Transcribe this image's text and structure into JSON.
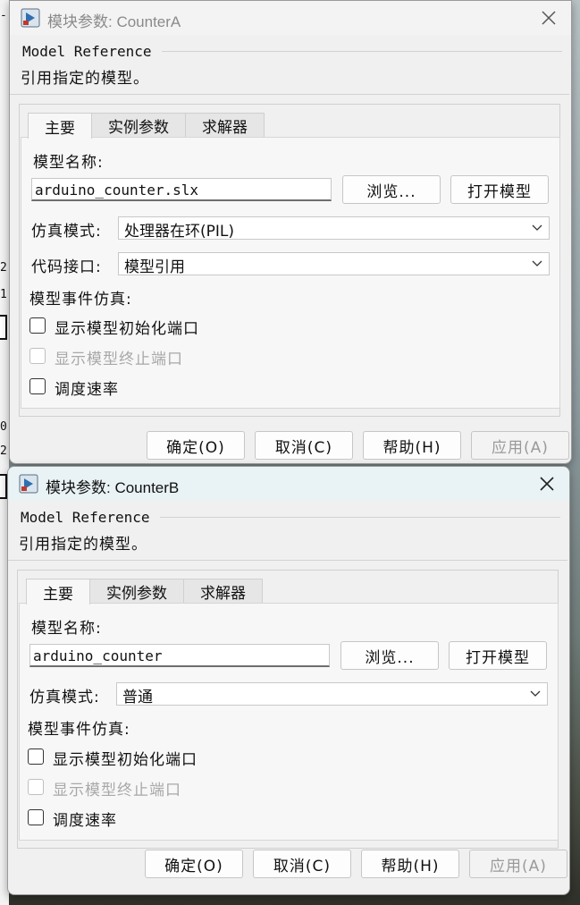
{
  "background": {
    "glyphs": [
      "-",
      "2",
      "1",
      "0",
      "0",
      "2",
      "0"
    ]
  },
  "dialogA": {
    "title": "模块参数: CounterA",
    "group_title": "Model Reference",
    "description": "引用指定的模型。",
    "tabs": [
      "主要",
      "实例参数",
      "求解器"
    ],
    "model_name_label": "模型名称:",
    "model_name_value": "arduino_counter.slx",
    "browse_label": "浏览...",
    "open_model_label": "打开模型",
    "sim_mode_label": "仿真模式:",
    "sim_mode_value": "处理器在环(PIL)",
    "code_interface_label": "代码接口:",
    "code_interface_value": "模型引用",
    "event_sim_label": "模型事件仿真:",
    "chk_init_port": "显示模型初始化端口",
    "chk_term_port": "显示模型终止端口",
    "chk_schedule": "调度速率",
    "ok_label": "确定(O)",
    "cancel_label": "取消(C)",
    "help_label": "帮助(H)",
    "apply_label": "应用(A)"
  },
  "dialogB": {
    "title": "模块参数: CounterB",
    "group_title": "Model Reference",
    "description": "引用指定的模型。",
    "tabs": [
      "主要",
      "实例参数",
      "求解器"
    ],
    "model_name_label": "模型名称:",
    "model_name_value": "arduino_counter",
    "browse_label": "浏览...",
    "open_model_label": "打开模型",
    "sim_mode_label": "仿真模式:",
    "sim_mode_value": "普通",
    "event_sim_label": "模型事件仿真:",
    "chk_init_port": "显示模型初始化端口",
    "chk_term_port": "显示模型终止端口",
    "chk_schedule": "调度速率",
    "ok_label": "确定(O)",
    "cancel_label": "取消(C)",
    "help_label": "帮助(H)",
    "apply_label": "应用(A)"
  },
  "icons": {
    "app": "simulink-block-icon",
    "close": "close-icon",
    "dropdown": "chevron-down-icon"
  }
}
